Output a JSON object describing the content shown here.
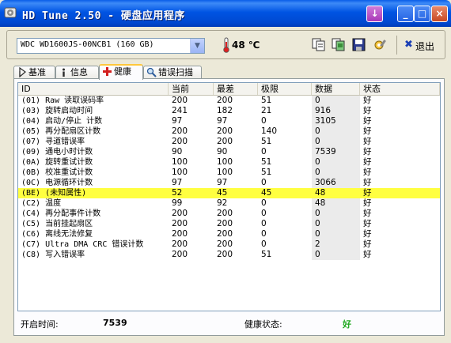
{
  "window": {
    "title": "HD Tune 2.50 - 硬盘应用程序",
    "title_buttons": {
      "download": "↓",
      "minimize": "_",
      "maximize": "□",
      "close": "×"
    }
  },
  "toolbar": {
    "drive": "WDC WD1600JS-00NCB1 (160 GB)",
    "temperature": "48 ℃",
    "icons": [
      "copy-text-icon",
      "copy-screenshot-icon",
      "save-icon",
      "options-icon"
    ],
    "exit_label": "退出"
  },
  "tabs": [
    {
      "label": "基准",
      "icon": "benchmark-icon"
    },
    {
      "label": "信息",
      "icon": "info-icon"
    },
    {
      "label": "健康",
      "icon": "health-icon",
      "active": true
    },
    {
      "label": "错误扫描",
      "icon": "error-scan-icon"
    }
  ],
  "table": {
    "columns": [
      "ID",
      "当前",
      "最差",
      "极限",
      "数据",
      "状态"
    ],
    "rows": [
      {
        "id": "(01) Raw 读取误码率",
        "current": "200",
        "worst": "200",
        "threshold": "51",
        "data": "0",
        "status": "好"
      },
      {
        "id": "(03) 旋转启动时间",
        "current": "241",
        "worst": "182",
        "threshold": "21",
        "data": "916",
        "status": "好"
      },
      {
        "id": "(04) 启动/停止 计数",
        "current": "97",
        "worst": "97",
        "threshold": "0",
        "data": "3105",
        "status": "好"
      },
      {
        "id": "(05) 再分配扇区计数",
        "current": "200",
        "worst": "200",
        "threshold": "140",
        "data": "0",
        "status": "好"
      },
      {
        "id": "(07) 寻道错误率",
        "current": "200",
        "worst": "200",
        "threshold": "51",
        "data": "0",
        "status": "好"
      },
      {
        "id": "(09) 通电小时计数",
        "current": "90",
        "worst": "90",
        "threshold": "0",
        "data": "7539",
        "status": "好"
      },
      {
        "id": "(0A) 旋转重试计数",
        "current": "100",
        "worst": "100",
        "threshold": "51",
        "data": "0",
        "status": "好"
      },
      {
        "id": "(0B) 校准重试计数",
        "current": "100",
        "worst": "100",
        "threshold": "51",
        "data": "0",
        "status": "好"
      },
      {
        "id": "(0C) 电源循环计数",
        "current": "97",
        "worst": "97",
        "threshold": "0",
        "data": "3066",
        "status": "好"
      },
      {
        "id": "(BE) (未知属性)",
        "current": "52",
        "worst": "45",
        "threshold": "45",
        "data": "48",
        "status": "好",
        "highlight": true
      },
      {
        "id": "(C2) 温度",
        "current": "99",
        "worst": "92",
        "threshold": "0",
        "data": "48",
        "status": "好"
      },
      {
        "id": "(C4) 再分配事件计数",
        "current": "200",
        "worst": "200",
        "threshold": "0",
        "data": "0",
        "status": "好"
      },
      {
        "id": "(C5) 当前挂起扇区",
        "current": "200",
        "worst": "200",
        "threshold": "0",
        "data": "0",
        "status": "好"
      },
      {
        "id": "(C6) 离线无法修复",
        "current": "200",
        "worst": "200",
        "threshold": "0",
        "data": "0",
        "status": "好"
      },
      {
        "id": "(C7) Ultra DMA CRC 错误计数",
        "current": "200",
        "worst": "200",
        "threshold": "0",
        "data": "2",
        "status": "好"
      },
      {
        "id": "(C8) 写入错误率",
        "current": "200",
        "worst": "200",
        "threshold": "51",
        "data": "0",
        "status": "好"
      }
    ]
  },
  "status": {
    "power_on_label": "开启时间:",
    "power_on_value": "7539",
    "health_label": "健康状态:",
    "health_value": "好"
  },
  "colors": {
    "highlight_row": "#ffff40",
    "health_good": "#22aa22",
    "titlebar": "#0054e3"
  }
}
